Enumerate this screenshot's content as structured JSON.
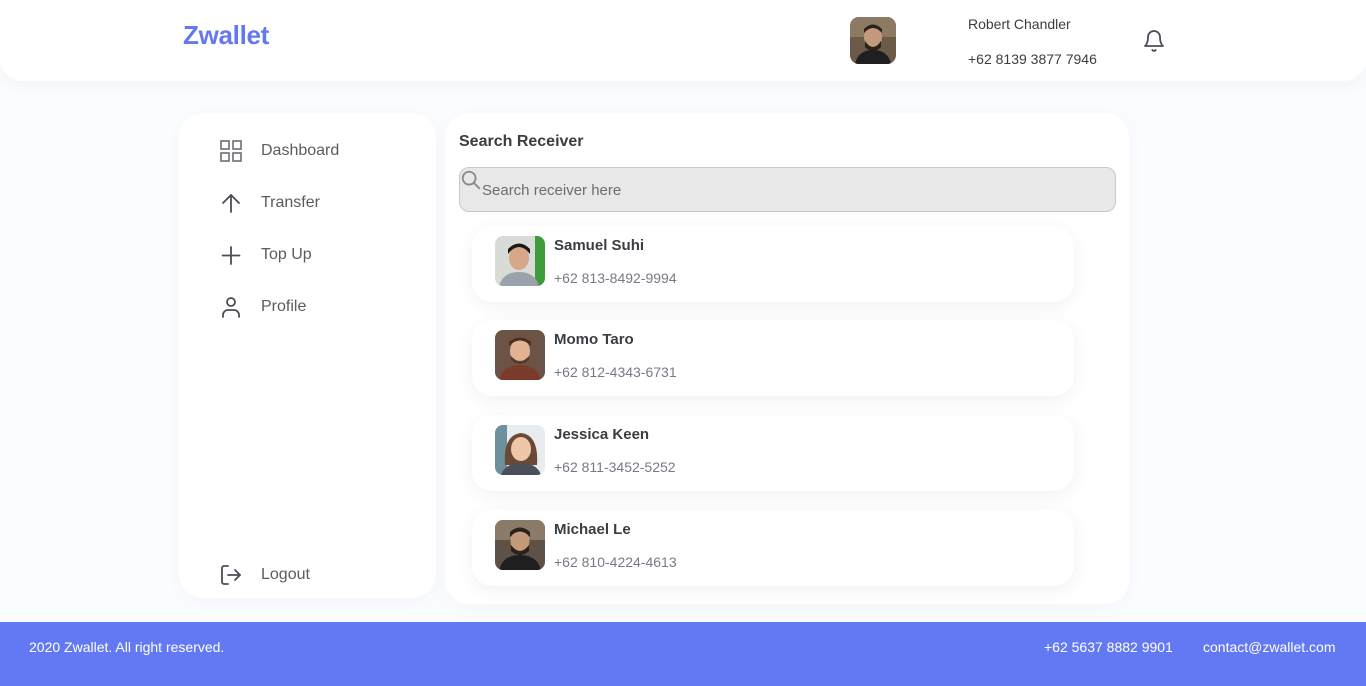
{
  "header": {
    "brand": "Zwallet",
    "user_name": "Robert Chandler",
    "user_phone": "+62 8139 3877 7946"
  },
  "sidebar": {
    "items": [
      {
        "label": "Dashboard",
        "icon": "grid-icon"
      },
      {
        "label": "Transfer",
        "icon": "arrow-up-icon"
      },
      {
        "label": "Top Up",
        "icon": "plus-icon"
      },
      {
        "label": "Profile",
        "icon": "user-icon"
      }
    ],
    "logout": {
      "label": "Logout",
      "icon": "logout-icon"
    }
  },
  "main": {
    "title": "Search Receiver",
    "search_placeholder": "Search receiver here",
    "receivers": [
      {
        "name": "Samuel Suhi",
        "phone": "+62 813-8492-9994"
      },
      {
        "name": "Momo Taro",
        "phone": "+62 812-4343-6731"
      },
      {
        "name": "Jessica Keen",
        "phone": "+62 811-3452-5252"
      },
      {
        "name": "Michael Le",
        "phone": "+62 810-4224-4613"
      }
    ]
  },
  "footer": {
    "copyright": "2020 Zwallet. All right reserved.",
    "phone": "+62 5637 8882 9901",
    "email": "contact@zwallet.com"
  },
  "colors": {
    "accent": "#6379f4",
    "background": "#fafcff",
    "text": "#3a3d42"
  }
}
